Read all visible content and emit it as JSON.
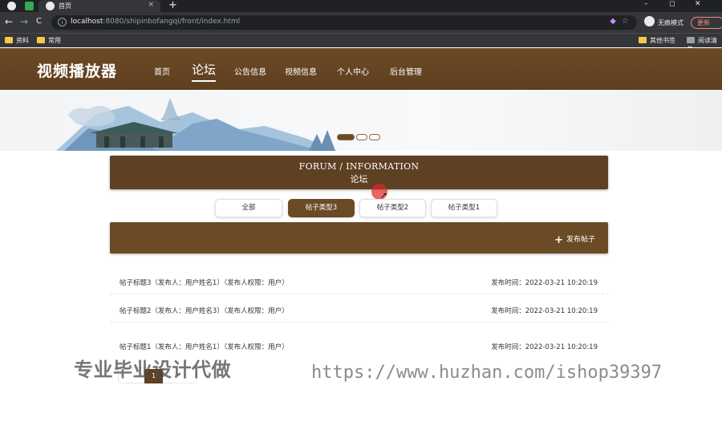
{
  "browser": {
    "tab_title": "首页",
    "tab_close": "×",
    "new_tab": "+",
    "win_controls": [
      "–",
      "◻",
      "✕"
    ],
    "nav": {
      "back": "←",
      "forward": "→",
      "reload": "C"
    },
    "url_host": "localhost",
    "url_rest": ":8080/shipinbofangqi/front/index.html",
    "incognito_label": "无痕模式",
    "update_label": "更新",
    "bookmarks": [
      "资料",
      "常用"
    ],
    "bookmarks_right": [
      "其他书签",
      "阅读清单"
    ]
  },
  "site": {
    "logo": "视频播放器",
    "menu": [
      "首页",
      "论坛",
      "公告信息",
      "视频信息",
      "个人中心",
      "后台管理"
    ],
    "active_menu": "论坛"
  },
  "banner": {
    "active_slide": 1,
    "slide_count": 3
  },
  "forum": {
    "title_en": "FORUM / INFORMATION",
    "title_cn": "论坛",
    "filters": [
      "全部",
      "帖子类型3",
      "帖子类型2",
      "帖子类型1"
    ],
    "active_filter": "帖子类型3",
    "publish_label": "发布帖子",
    "posts": [
      {
        "title": "帖子标题3（发布人：用户姓名1）（发布人权限：用户）",
        "time": "发布时间：2022-03-21 10:20:19"
      },
      {
        "title": "帖子标题2（发布人：用户姓名3）（发布人权限：用户）",
        "time": "发布时间：2022-03-21 10:20:19"
      },
      {
        "title": "帖子标题1（发布人：用户姓名1）（发布人权限：用户）",
        "time": "发布时间：2022-03-21 10:20:19"
      }
    ],
    "current_page": "1"
  },
  "watermarks": {
    "left": "专业毕业设计代做",
    "right": "https://www.huzhan.com/ishop39397"
  },
  "colors": {
    "brand_brown": "#6b4a26",
    "dark_brown": "#5e4022"
  }
}
